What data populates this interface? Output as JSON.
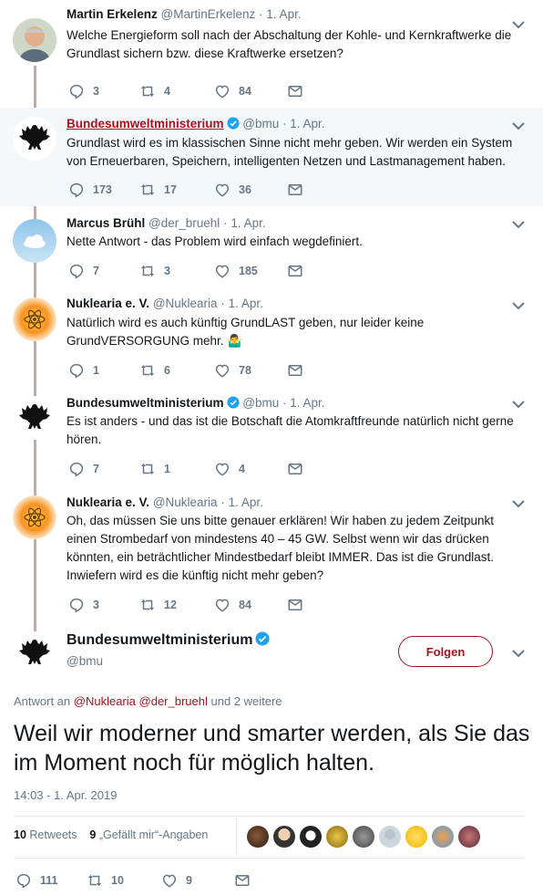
{
  "tweets": [
    {
      "name": "Martin Erkelenz",
      "handle": "@MartinErkelenz",
      "sep": " · ",
      "date": "1. Apr.",
      "text": "Welche Energieform soll nach der Abschaltung der Kohle- und Kernkraftwerke die Grundlast sichern bzw. diese Kraftwerke ersetzen?",
      "replies": "3",
      "retweets": "4",
      "likes": "84"
    },
    {
      "name": "Bundesumweltministerium",
      "handle": "@bmu",
      "sep": " · ",
      "date": "1. Apr.",
      "text": "Grundlast wird es im klassischen Sinne nicht mehr geben. Wir werden ein System von Erneuerbaren, Speichern, intelligenten Netzen und Lastmanagement haben.",
      "replies": "173",
      "retweets": "17",
      "likes": "36"
    },
    {
      "name": "Marcus Brühl",
      "handle": "@der_bruehl",
      "sep": " · ",
      "date": "1. Apr.",
      "text": "Nette Antwort - das Problem wird einfach wegdefiniert.",
      "replies": "7",
      "retweets": "3",
      "likes": "185"
    },
    {
      "name": "Nuklearia e. V.",
      "handle": "@Nuklearia",
      "sep": " · ",
      "date": "1. Apr.",
      "text": "Natürlich wird es auch künftig GrundLAST geben, nur leider keine GrundVERSORGUNG mehr. 🤷‍♂️",
      "replies": "1",
      "retweets": "6",
      "likes": "78"
    },
    {
      "name": "Bundesumweltministerium",
      "handle": "@bmu",
      "sep": " · ",
      "date": "1. Apr.",
      "text": "Es ist anders - und das ist die Botschaft die Atomkraftfreunde natürlich nicht gerne hören.",
      "replies": "7",
      "retweets": "1",
      "likes": "4"
    },
    {
      "name": "Nuklearia e. V.",
      "handle": "@Nuklearia",
      "sep": " · ",
      "date": "1. Apr.",
      "text": "Oh, das müssen Sie uns bitte genauer erklären! Wir haben zu jedem Zeitpunkt einen Strombedarf von mindestens 40 – 45 GW. Selbst wenn wir das drücken könnten, ein beträchtlicher Mindestbedarf bleibt IMMER. Das ist die Grundlast. Inwiefern wird es die künftig nicht mehr geben?",
      "replies": "3",
      "retweets": "12",
      "likes": "84"
    }
  ],
  "main": {
    "name": "Bundesumweltministerium",
    "handle": "@bmu",
    "follow_label": "Folgen",
    "reply_prefix": "Antwort an ",
    "reply_user1": "@Nuklearia",
    "reply_user2": "@der_bruehl",
    "reply_suffix": " und 2 weitere",
    "text": "Weil wir moderner und smarter werden, als Sie das im Moment noch für möglich halten.",
    "timestamp": "14:03 - 1. Apr. 2019",
    "retweets_count": "10",
    "retweets_label": "Retweets",
    "likes_count": "9",
    "likes_label": "„Gefällt mir“-Angaben",
    "replies": "111",
    "retweets": "10",
    "likes": "9"
  },
  "colors": {
    "accent": "#a4131e",
    "thread_line": "#c9a7a7",
    "verified": "#1da1f2",
    "muted": "#657786"
  }
}
